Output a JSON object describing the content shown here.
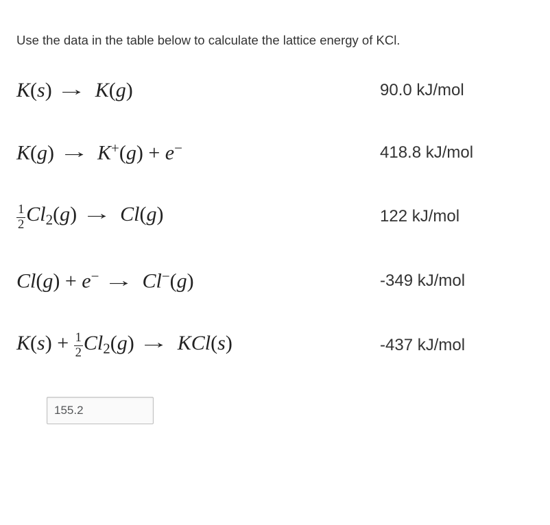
{
  "prompt": "Use the data in the table below to calculate the lattice energy of KCl.",
  "rows": [
    {
      "value": "90.0 kJ/mol"
    },
    {
      "value": "418.8 kJ/mol"
    },
    {
      "value": "122 kJ/mol"
    },
    {
      "value": "-349 kJ/mol"
    },
    {
      "value": "-437 kJ/mol"
    }
  ],
  "equation_parts": {
    "K": "K",
    "Cl": "Cl",
    "KCl": "KCl",
    "e": "e",
    "s": "s",
    "g": "g",
    "plus": "+",
    "superPlus": "+",
    "superMinus": "−",
    "half_num": "1",
    "half_den": "2",
    "two": "2"
  },
  "answer_value": "155.2"
}
